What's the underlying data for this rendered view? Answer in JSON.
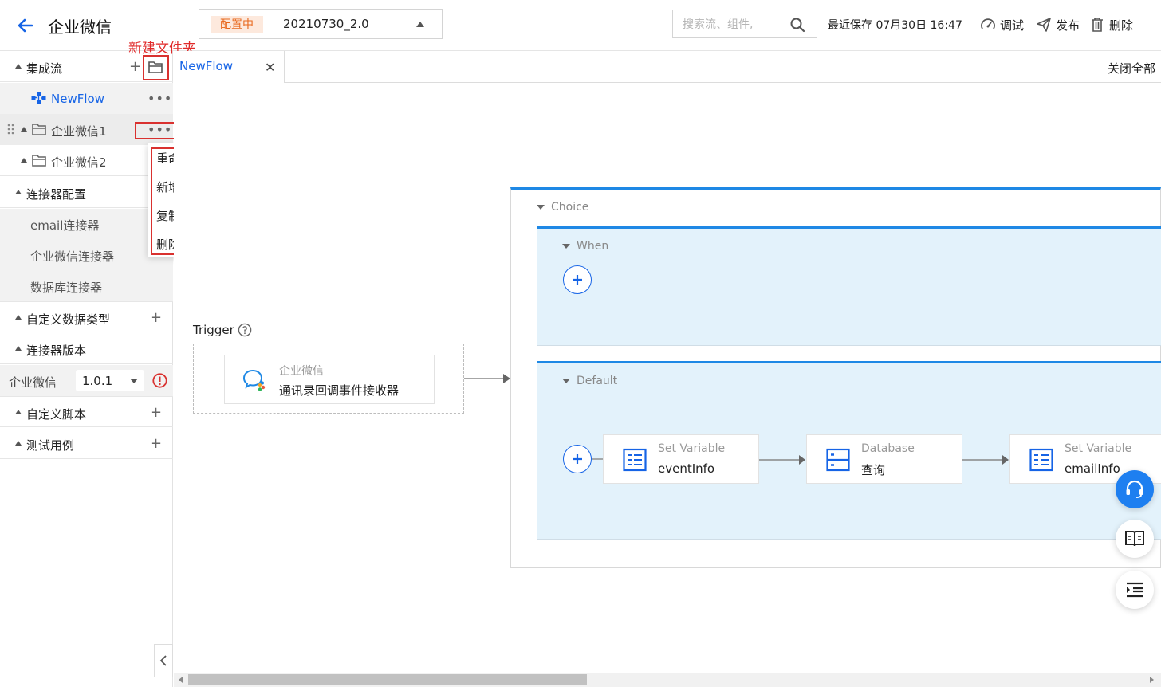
{
  "header": {
    "title": "企业微信",
    "version_status": "配置中",
    "version_value": "20210730_2.0",
    "search_placeholder": "搜索流、组件,",
    "saved_text": "最近保存 07月30日 16:47",
    "actions": {
      "debug": "调试",
      "publish": "发布",
      "delete": "删除"
    }
  },
  "sidebar": {
    "integration_flows": "集成流",
    "new_folder_annotation": "新建文件夹",
    "flow_item": "NewFlow",
    "folder1": "企业微信1",
    "folder2": "企业微信2",
    "context_menu": [
      "重命名",
      "新增流",
      "复制",
      "删除"
    ],
    "connector_config": "连接器配置",
    "connectors": [
      "email连接器",
      "企业微信连接器",
      "数据库连接器"
    ],
    "custom_types": "自定义数据类型",
    "connector_version": "连接器版本",
    "version_row": {
      "name": "企业微信",
      "value": "1.0.1"
    },
    "custom_scripts": "自定义脚本",
    "test_cases": "测试用例"
  },
  "tabs": {
    "active": "NewFlow",
    "close_all": "关闭全部"
  },
  "canvas": {
    "trigger_label": "Trigger",
    "trigger_category": "企业微信",
    "trigger_name": "通讯录回调事件接收器",
    "choice_title": "Choice",
    "when_title": "When",
    "default_title": "Default",
    "nodes": [
      {
        "category": "Set Variable",
        "name": "eventInfo"
      },
      {
        "category": "Database",
        "name": "查询"
      },
      {
        "category": "Set Variable",
        "name": "emailInfo"
      }
    ]
  },
  "colors": {
    "accent": "#1664e6",
    "annotation": "#d9312f",
    "status_bg": "#fde9dd",
    "status_text": "#e8671c",
    "branch_bg": "#e3f2fb"
  }
}
